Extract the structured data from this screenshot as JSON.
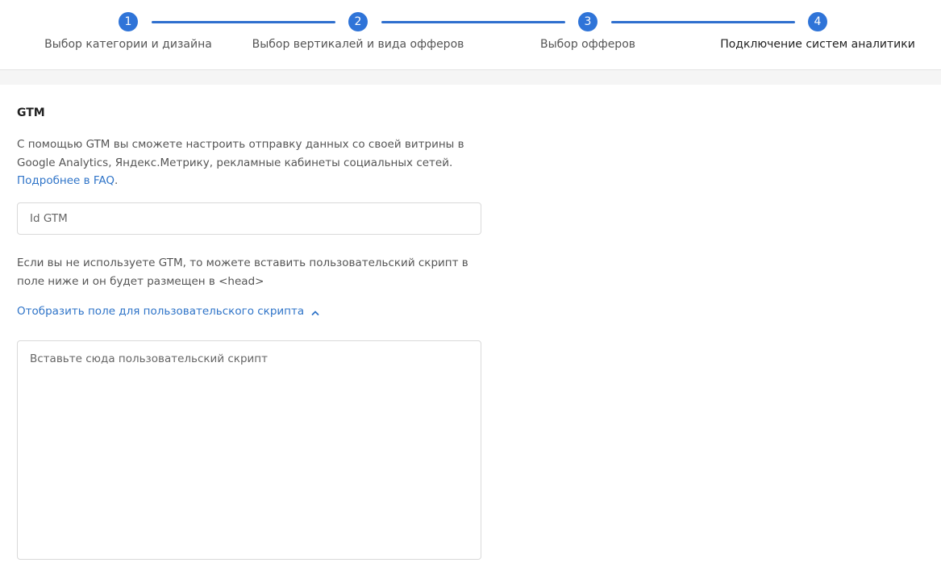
{
  "stepper": {
    "steps": [
      {
        "number": "1",
        "label": "Выбор категории и дизайна"
      },
      {
        "number": "2",
        "label": "Выбор вертикалей и вида офферов"
      },
      {
        "number": "3",
        "label": "Выбор офферов"
      },
      {
        "number": "4",
        "label": "Подключение систем аналитики"
      }
    ],
    "active_step": 4
  },
  "gtm": {
    "title": "GTM",
    "description": "С помощью GTM вы сможете настроить отправку данных со своей витрины в Google Analytics, Яндекс.Метрику, рекламные кабинеты социальных сетей.",
    "faq_link": "Подробнее в FAQ",
    "faq_suffix": ".",
    "id_placeholder": "Id GTM"
  },
  "custom_script": {
    "note": "Если вы не используете GTM, то можете вставить пользовательский скрипт в поле ниже и он будет размещен в <head>",
    "toggle_label": "Отобразить поле для пользовательского скрипта",
    "toggle_icon": "chevron-up-icon",
    "textarea_placeholder": "Вставьте сюда пользовательский скрипт"
  },
  "colors": {
    "accent": "#2f74d8",
    "link": "#2f74c8"
  }
}
